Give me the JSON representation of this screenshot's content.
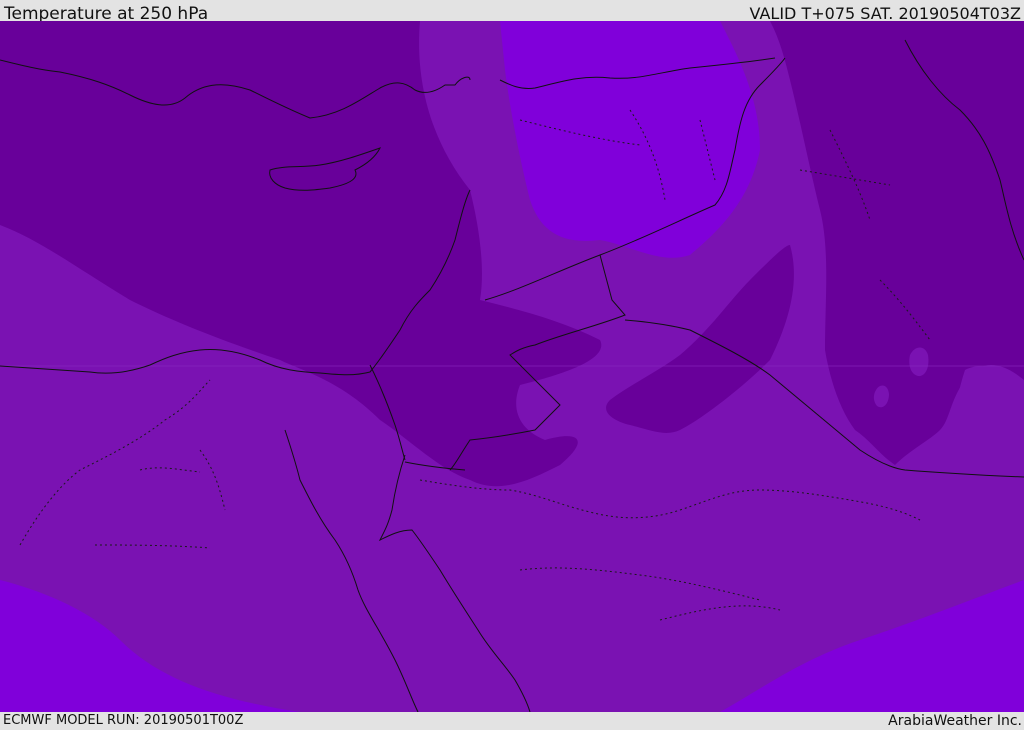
{
  "header": {
    "title": "Temperature at 250 hPa",
    "valid": "VALID T+075 SAT. 20190504T03Z"
  },
  "footer": {
    "model_run": "ECMWF MODEL RUN: 20190501T00Z",
    "credit": "ArabiaWeather Inc."
  },
  "colors": {
    "band_coldest": "#68009a",
    "band_mid": "#7a12b2",
    "band_warm": "#8000da"
  }
}
